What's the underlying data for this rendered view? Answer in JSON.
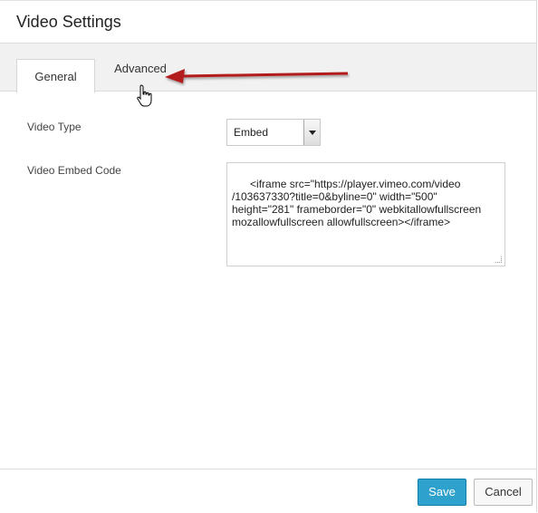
{
  "dialog": {
    "title": "Video Settings"
  },
  "tabs": [
    {
      "label": "General",
      "active": true
    },
    {
      "label": "Advanced",
      "active": false
    }
  ],
  "form": {
    "video_type_label": "Video Type",
    "video_type_value": "Embed",
    "embed_code_label": "Video Embed Code",
    "embed_code_value": "<iframe src=\"https://player.vimeo.com/video\n/103637330?title=0&byline=0\" width=\"500\"\nheight=\"281\" frameborder=\"0\" webkitallowfullscreen\nmozallowfullscreen allowfullscreen></iframe>"
  },
  "footer": {
    "save_label": "Save",
    "cancel_label": "Cancel"
  },
  "colors": {
    "accent": "#2ea2cc",
    "annotation_arrow": "#b31b1b"
  },
  "icons": [
    "select-arrow-icon",
    "hand-cursor-icon",
    "resize-grip-icon",
    "annotation-arrow"
  ]
}
